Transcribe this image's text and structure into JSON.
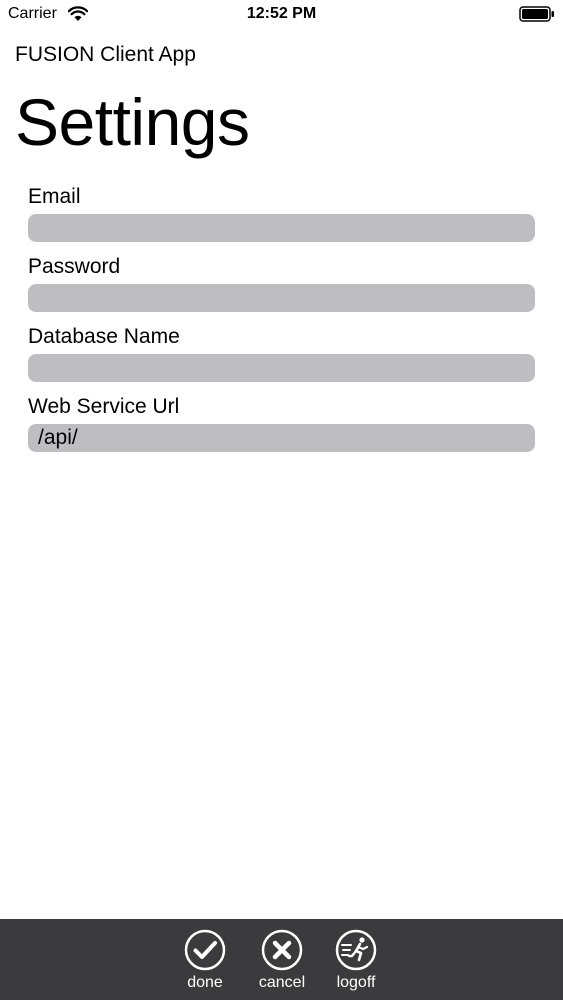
{
  "status_bar": {
    "carrier": "Carrier",
    "time": "12:52 PM"
  },
  "header": {
    "app_name": "FUSION Client App",
    "page_title": "Settings"
  },
  "form": {
    "fields": [
      {
        "label": "Email",
        "value": ""
      },
      {
        "label": "Password",
        "value": ""
      },
      {
        "label": "Database Name",
        "value": ""
      },
      {
        "label": "Web Service Url",
        "value": "/api/"
      }
    ]
  },
  "toolbar": {
    "done_label": "done",
    "cancel_label": "cancel",
    "logoff_label": "logoff"
  },
  "colors": {
    "input_bg": "#bebdc2",
    "toolbar_bg": "#3b3b3d",
    "toolbar_fg": "#ffffff"
  },
  "icons": {
    "done": "checkmark-circle-icon",
    "cancel": "x-circle-icon",
    "logoff": "running-person-circle-icon"
  }
}
